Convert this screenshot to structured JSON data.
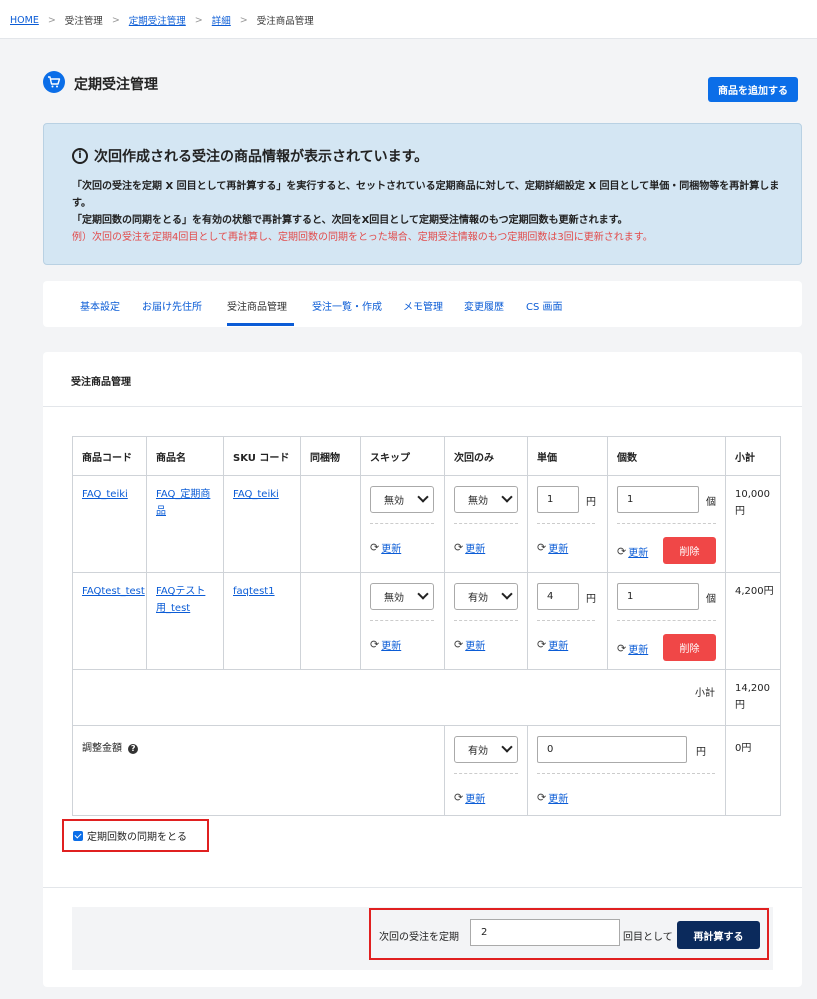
{
  "breadcrumb": {
    "items": [
      {
        "label": "HOME",
        "link": true
      },
      {
        "label": "受注管理",
        "link": false
      },
      {
        "label": "定期受注管理",
        "link": true
      },
      {
        "label": "詳細",
        "link": true
      },
      {
        "label": "受注商品管理",
        "link": false
      }
    ],
    "separator": ">"
  },
  "page": {
    "title": "定期受注管理",
    "icon": "cart-icon",
    "add_button": "商品を追加する"
  },
  "info": {
    "title": "次回作成される受注の商品情報が表示されています。",
    "line1": "「次回の受注を定期 X 回目として再計算する」を実行すると、セットされている定期商品に対して、定期詳細設定 X 回目として単価・同梱物等を再計算します。",
    "line2": "「定期回数の同期をとる」を有効の状態で再計算すると、次回をX回目として定期受注情報のもつ定期回数も更新されます。",
    "example": "例）次回の受注を定期4回目として再計算し、定期回数の同期をとった場合、定期受注情報のもつ定期回数は3回に更新されます。"
  },
  "tabs": [
    {
      "label": "基本設定"
    },
    {
      "label": "お届け先住所"
    },
    {
      "label": "受注商品管理"
    },
    {
      "label": "受注一覧・作成"
    },
    {
      "label": "メモ管理"
    },
    {
      "label": "変更履歴"
    },
    {
      "label": "CS 画面"
    }
  ],
  "card": {
    "title": "受注商品管理"
  },
  "table": {
    "headers": [
      "商品コード",
      "商品名",
      "SKU コード",
      "同梱物",
      "スキップ",
      "次回のみ",
      "単価",
      "個数",
      "小計"
    ],
    "rows": [
      {
        "code": "FAQ_teiki",
        "name": "FAQ_定期商品",
        "sku": "FAQ_teiki",
        "skip": "無効",
        "next_only": "無効",
        "price": "1",
        "qty": "1",
        "subtotal": "10,000円"
      },
      {
        "code": "FAQtest_test",
        "name": "FAQテスト用_test",
        "sku": "faqtest1",
        "skip": "無効",
        "next_only": "有効",
        "price": "4",
        "qty": "1",
        "subtotal": "4,200円"
      }
    ],
    "unit_yen": "円",
    "unit_pieces": "個",
    "update_label": "更新",
    "delete_label": "削除",
    "subtotal_label": "小計",
    "subtotal_value": "14,200円",
    "adjustment": {
      "label": "調整金額",
      "status": "有効",
      "amount": "0",
      "value": "0円"
    }
  },
  "sync_checkbox": {
    "label": "定期回数の同期をとる",
    "checked": true
  },
  "recalc": {
    "prefix": "次回の受注を定期",
    "value": "2",
    "suffix": "回目として",
    "button": "再計算する"
  }
}
